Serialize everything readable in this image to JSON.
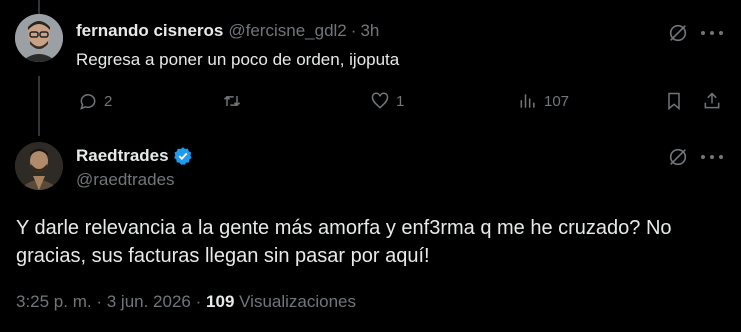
{
  "reply": {
    "name": "fernando cisneros",
    "handle": "@fercisne_gdl2",
    "separator": "·",
    "time": "3h",
    "text": "Regresa a poner un poco de orden, ijoputa",
    "replies": "2",
    "likes": "1",
    "views": "107"
  },
  "main": {
    "name": "Raedtrades",
    "handle": "@raedtrades",
    "text": "Y darle relevancia a la gente más amorfa y enf3rma q me he cruzado? No gracias, sus facturas llegan sin pasar por aquí!",
    "timestamp": "3:25 p. m.",
    "separator": "·",
    "date": "3 jun. 2026",
    "separator2": "·",
    "views_count": "109",
    "views_label": "Visualizaciones"
  },
  "colors": {
    "background": "#000000",
    "text": "#e7e9ea",
    "muted": "#71767b",
    "verified": "#1d9bf0"
  }
}
